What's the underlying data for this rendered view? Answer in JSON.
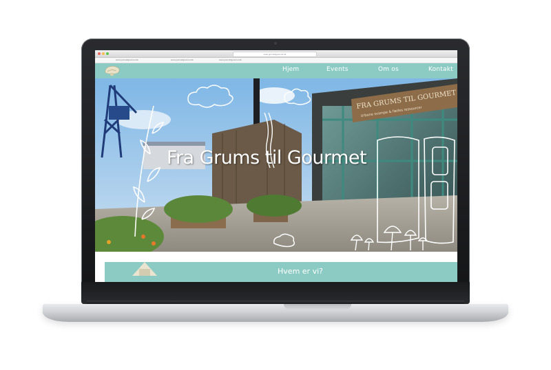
{
  "browser": {
    "tabs": [
      "www.grumstilgourmet.dk",
      "www.grumstilgourmet.dk",
      "www.grumstilgourmet.dk"
    ],
    "url": "www.grumstilgourmet.dk"
  },
  "nav": {
    "items": [
      "Hjem",
      "Events",
      "Om os",
      "Kontakt"
    ]
  },
  "hero": {
    "title": "Fra Grums til Gourmet",
    "sign_line1": "FRA GRUMS TIL GOURMET",
    "sign_line2": "Urbane svampe & fælles ressourcer"
  },
  "about": {
    "title": "Hvem er vi?"
  },
  "colors": {
    "accent": "#8ccbc4",
    "nav_text": "#ffffff"
  }
}
